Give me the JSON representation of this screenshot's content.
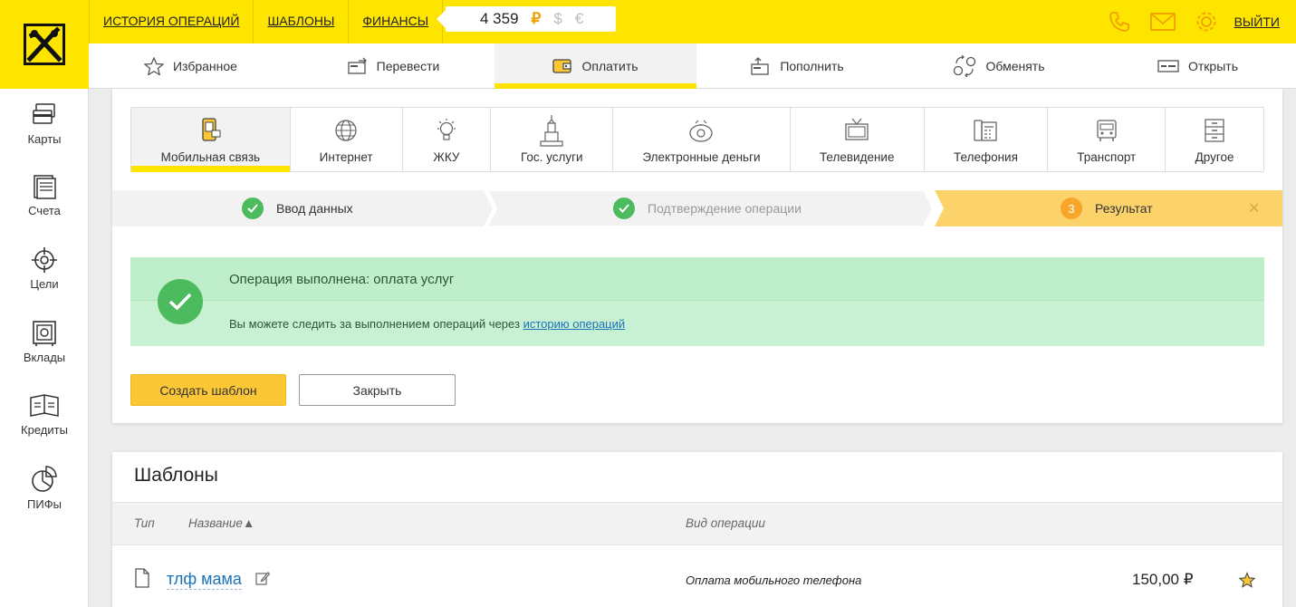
{
  "brand": {
    "accent": "#fee500",
    "button_yellow": "#fbc737",
    "success_bg": "#c8f0d2",
    "link": "#1a73b8"
  },
  "topnav": {
    "history": "ИСТОРИЯ ОПЕРАЦИЙ",
    "templates": "ШАБЛОНЫ",
    "finance": "ФИНАНСЫ",
    "balance": "4 359",
    "cur_rub": "₽",
    "cur_usd": "$",
    "cur_eur": "€",
    "logout": "ВЫЙТИ",
    "icons": [
      "phone-icon",
      "mail-icon",
      "gear-icon"
    ]
  },
  "subnav": {
    "items": [
      {
        "label": "Избранное",
        "icon": "star-icon"
      },
      {
        "label": "Перевести",
        "icon": "transfer-icon"
      },
      {
        "label": "Оплатить",
        "icon": "wallet-icon"
      },
      {
        "label": "Пополнить",
        "icon": "topup-icon"
      },
      {
        "label": "Обменять",
        "icon": "exchange-icon"
      },
      {
        "label": "Открыть",
        "icon": "open-icon"
      }
    ],
    "active": "Оплатить"
  },
  "sidebar": {
    "items": [
      {
        "label": "Карты",
        "icon": "cards-icon"
      },
      {
        "label": "Счета",
        "icon": "accounts-icon"
      },
      {
        "label": "Цели",
        "icon": "target-icon"
      },
      {
        "label": "Вклады",
        "icon": "safe-icon"
      },
      {
        "label": "Кредиты",
        "icon": "credit-icon"
      },
      {
        "label": "ПИФы",
        "icon": "pie-icon"
      }
    ]
  },
  "categories": {
    "items": [
      {
        "label": "Мобильная связь",
        "icon": "mobile-icon"
      },
      {
        "label": "Интернет",
        "icon": "globe-icon"
      },
      {
        "label": "ЖКУ",
        "icon": "bulb-icon"
      },
      {
        "label": "Гос. услуги",
        "icon": "tower-icon"
      },
      {
        "label": "Электронные деньги",
        "icon": "coins-icon"
      },
      {
        "label": "Телевидение",
        "icon": "tv-icon"
      },
      {
        "label": "Телефония",
        "icon": "phone-station-icon"
      },
      {
        "label": "Транспорт",
        "icon": "bus-icon"
      },
      {
        "label": "Другое",
        "icon": "cabinet-icon"
      }
    ],
    "active": "Мобильная связь"
  },
  "steps": {
    "step1": "Ввод данных",
    "step2": "Подтверждение операции",
    "step3_num": "3",
    "step3": "Результат",
    "close": "✕"
  },
  "result": {
    "title": "Операция выполнена: оплата услуг",
    "text": "Вы можете следить за выполнением операций через ",
    "link": "историю операций"
  },
  "buttons": {
    "create_template": "Создать шаблон",
    "close": "Закрыть"
  },
  "templates": {
    "title": "Шаблоны",
    "columns": {
      "type": "Тип",
      "name": "Название▲",
      "operation": "Вид операции"
    },
    "rows": [
      {
        "name": "тлф мама",
        "operation": "Оплата мобильного телефона",
        "amount": "150,00 ₽",
        "favorite": true
      }
    ]
  }
}
